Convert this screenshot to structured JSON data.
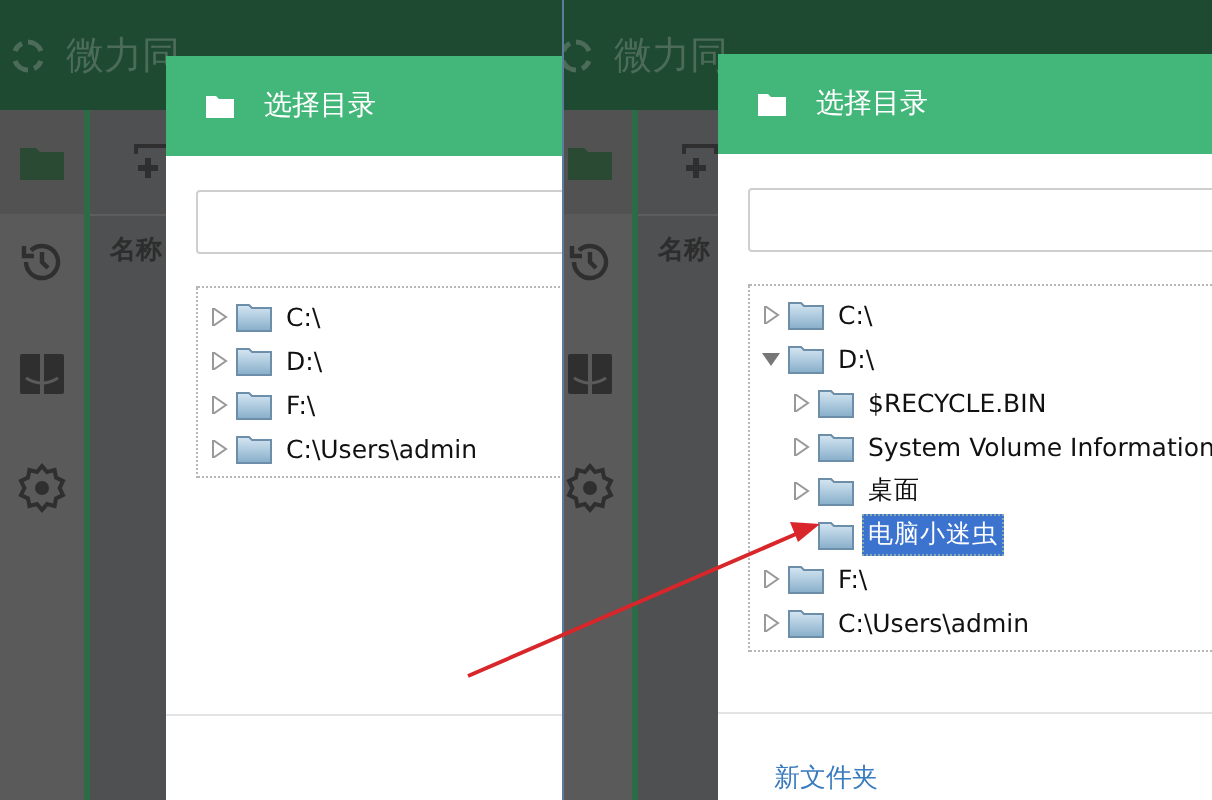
{
  "panels": [
    {
      "app": {
        "title": "微力同",
        "column_header": "名称"
      },
      "dialog": {
        "title": "选择目录",
        "tree": [
          {
            "label": "C:\\",
            "kind": "branch",
            "expanded": false,
            "selected": false
          },
          {
            "label": "D:\\",
            "kind": "branch",
            "expanded": false,
            "selected": false
          },
          {
            "label": "F:\\",
            "kind": "branch",
            "expanded": false,
            "selected": false
          },
          {
            "label": "C:\\Users\\admin",
            "kind": "branch",
            "expanded": false,
            "selected": false
          }
        ]
      }
    },
    {
      "app": {
        "title": "微力同",
        "column_header": "名称"
      },
      "dialog": {
        "title": "选择目录",
        "tree": [
          {
            "label": "C:\\",
            "kind": "branch",
            "expanded": false,
            "selected": false
          },
          {
            "label": "D:\\",
            "kind": "branch",
            "expanded": true,
            "selected": false,
            "children": [
              {
                "label": "$RECYCLE.BIN",
                "kind": "branch",
                "expanded": false,
                "selected": false
              },
              {
                "label": "System Volume Information",
                "kind": "branch",
                "expanded": false,
                "selected": false
              },
              {
                "label": "桌面",
                "kind": "branch",
                "expanded": false,
                "selected": false
              },
              {
                "label": "电脑小迷虫",
                "kind": "leaf",
                "selected": true
              }
            ]
          },
          {
            "label": "F:\\",
            "kind": "branch",
            "expanded": false,
            "selected": false
          },
          {
            "label": "C:\\Users\\admin",
            "kind": "branch",
            "expanded": false,
            "selected": false
          }
        ],
        "footer_link": "新文件夹"
      }
    }
  ]
}
